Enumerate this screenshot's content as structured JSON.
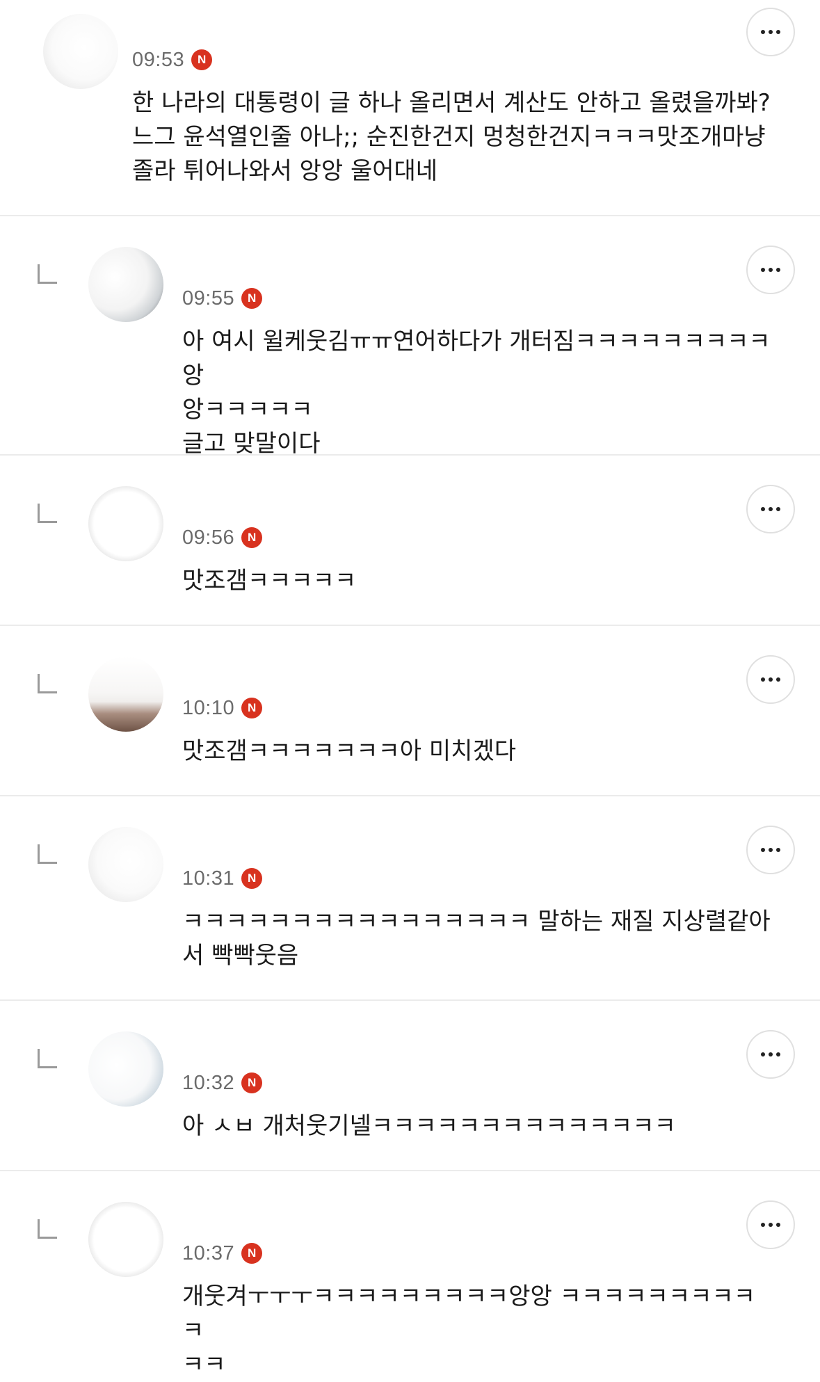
{
  "comments": [
    {
      "time": "09:53",
      "badge": "N",
      "text": "한 나라의 대통령이 글 하나 올리면서 계산도 안하고 올렸을까봐?\n느그 윤석열인줄 아나;; 순진한건지 멍청한건지ㅋㅋㅋ맛조개마냥\n졸라 튀어나와서 앙앙 울어대네",
      "is_reply": false
    },
    {
      "time": "09:55",
      "badge": "N",
      "text": "아 여시 윌케웃김ㅠㅠ연어하다가 개터짐ㅋㅋㅋㅋㅋㅋㅋㅋㅋ앙\n앙ㅋㅋㅋㅋㅋ\n글고 맞말이다",
      "is_reply": true
    },
    {
      "time": "09:56",
      "badge": "N",
      "text": "맛조갬ㅋㅋㅋㅋㅋ",
      "is_reply": true
    },
    {
      "time": "10:10",
      "badge": "N",
      "text": "맛조갬ㅋㅋㅋㅋㅋㅋㅋ아 미치겠다",
      "is_reply": true
    },
    {
      "time": "10:31",
      "badge": "N",
      "text": "ㅋㅋㅋㅋㅋㅋㅋㅋㅋㅋㅋㅋㅋㅋㅋㅋ 말하는 재질 지상렬같아\n서 빡빡웃음",
      "is_reply": true
    },
    {
      "time": "10:32",
      "badge": "N",
      "text": "아 ㅅㅂ 개처웃기넬ㅋㅋㅋㅋㅋㅋㅋㅋㅋㅋㅋㅋㅋㅋ",
      "is_reply": true
    },
    {
      "time": "10:37",
      "badge": "N",
      "text": "개웃겨ㅜㅜㅜㅋㅋㅋㅋㅋㅋㅋㅋㅋ앙앙 ㅋㅋㅋㅋㅋㅋㅋㅋㅋㅋ\nㅋㅋ",
      "is_reply": true
    }
  ],
  "colors": {
    "badge": "#d8321f",
    "divider": "#ebebeb",
    "time": "#6b6b6b",
    "text": "#1a1a1a"
  },
  "icons": {
    "more": "more-horizontal-icon",
    "reply": "reply-corner-icon",
    "badge": "new-badge-icon"
  }
}
